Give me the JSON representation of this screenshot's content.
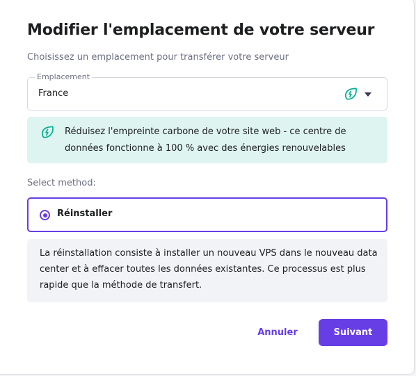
{
  "modal": {
    "title": "Modifier l'emplacement de votre serveur",
    "subtitle": "Choisissez un emplacement pour transférer votre serveur"
  },
  "location_select": {
    "label": "Emplacement",
    "value": "France",
    "icons": [
      "eco-leaf-icon",
      "chevron-down-icon"
    ]
  },
  "eco_notice": {
    "icon": "eco-leaf-icon",
    "text": "Réduisez l'empreinte carbone de votre site web - ce centre de données fonctionne à 100 % avec des énergies renouvelables"
  },
  "method": {
    "label": "Select method:",
    "options": [
      {
        "label": "Réinstaller",
        "selected": true
      }
    ],
    "description": "La réinstallation consiste à installer un nouveau VPS dans le nouveau data center et à effacer toutes les données existantes. Ce processus est plus rapide que la méthode de transfert."
  },
  "actions": {
    "cancel_label": "Annuler",
    "next_label": "Suivant"
  },
  "colors": {
    "accent": "#673de6",
    "eco_green": "#00b090",
    "eco_bg": "#def4f0",
    "info_bg": "#f2f3f6"
  }
}
